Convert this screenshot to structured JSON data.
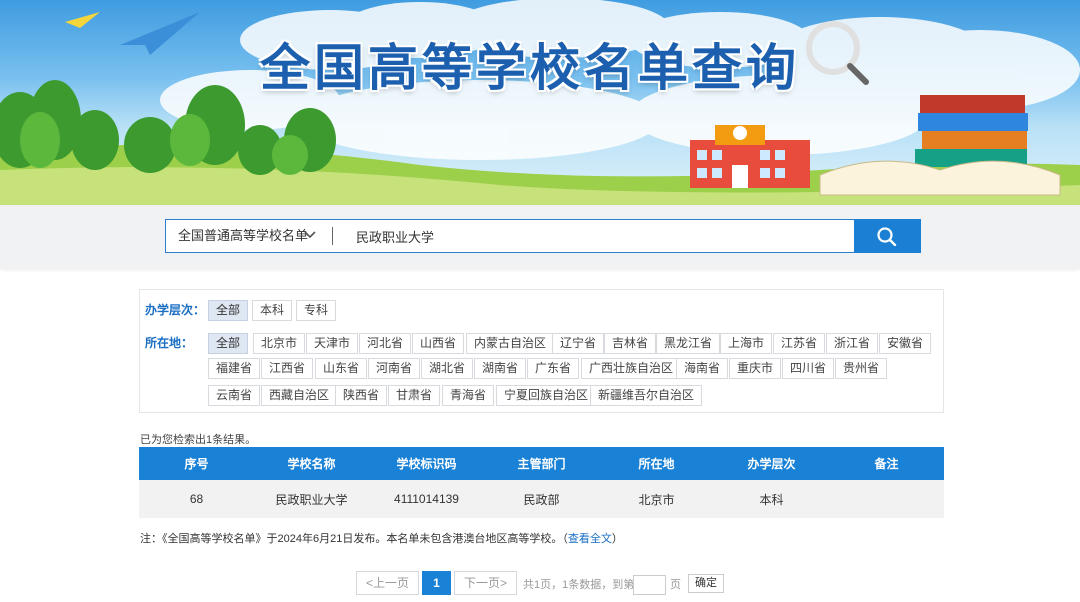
{
  "banner": {
    "title": "全国高等学校名单查询"
  },
  "search": {
    "scope": "全国普通高等学校名单",
    "query": "民政职业大学"
  },
  "filters": {
    "level_label": "办学层次：",
    "levels": [
      "全部",
      "本科",
      "专科"
    ],
    "location_label": "所在地：",
    "locations": [
      "全部",
      "北京市",
      "天津市",
      "河北省",
      "山西省",
      "内蒙古自治区",
      "辽宁省",
      "吉林省",
      "黑龙江省",
      "上海市",
      "江苏省",
      "浙江省",
      "安徽省",
      "福建省",
      "江西省",
      "山东省",
      "河南省",
      "湖北省",
      "湖南省",
      "广东省",
      "广西壮族自治区",
      "海南省",
      "重庆市",
      "四川省",
      "贵州省",
      "云南省",
      "西藏自治区",
      "陕西省",
      "甘肃省",
      "青海省",
      "宁夏回族自治区",
      "新疆维吾尔自治区"
    ]
  },
  "results": {
    "count_text": "已为您检索出1条结果。",
    "headers": [
      "序号",
      "学校名称",
      "学校标识码",
      "主管部门",
      "所在地",
      "办学层次",
      "备注"
    ],
    "rows": [
      [
        "68",
        "民政职业大学",
        "4111014139",
        "民政部",
        "北京市",
        "本科",
        ""
      ]
    ]
  },
  "note": {
    "text": "注：《全国高等学校名单》于2024年6月21日发布。本名单未包含港澳台地区高等学校。（",
    "link": "查看全文",
    "suffix": "）"
  },
  "pagination": {
    "prev": "<上一页",
    "current": "1",
    "next": "下一页>",
    "summary": "共1页，1条数据，到第",
    "page_unit": "页",
    "confirm": "确定"
  }
}
